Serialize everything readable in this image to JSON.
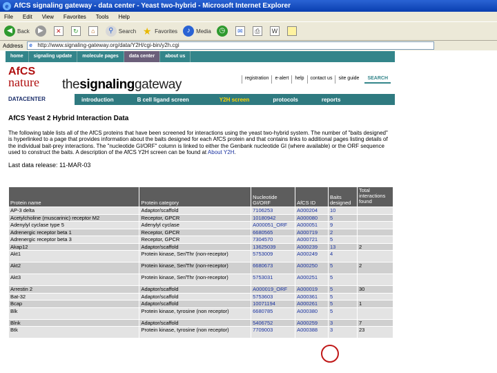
{
  "window": {
    "title": "AfCS signaling gateway - data center - Yeast two-hybrid - Microsoft Internet Explorer"
  },
  "menu": [
    "File",
    "Edit",
    "View",
    "Favorites",
    "Tools",
    "Help"
  ],
  "toolbar": {
    "back": "Back",
    "search": "Search",
    "favorites": "Favorites",
    "media": "Media"
  },
  "address": {
    "label": "Address",
    "url": "http://www.signaling-gateway.org/data/Y2H/cgi-bin/y2h.cgi"
  },
  "topnav": [
    "home",
    "signaling update",
    "molecule pages",
    "data center",
    "about us"
  ],
  "topnav_active": "data center",
  "logo": {
    "afcs_top": "AfCS",
    "afcs_bottom": "nature",
    "site_prefix": "the",
    "site_bold": "signaling",
    "site_suffix": "gateway"
  },
  "utilnav": [
    "registration",
    "e-alert",
    "help",
    "contact us",
    "site guide"
  ],
  "search_label": "SEARCH",
  "datacenter_label": "DATACENTER",
  "secnav": [
    "introduction",
    "B cell ligand screen",
    "Y2H screen",
    "protocols",
    "reports"
  ],
  "secnav_active": "Y2H screen",
  "heading": "AfCS Yeast 2 Hybrid Interaction Data",
  "intro": "The following table lists all of the AfCS proteins that have been screened for interactions using the yeast two-hybrid system. The number of \"baits designed\" is hyperlinked to a page that provides information about the baits designed for each AfCS protein and that contains links to additional pages listing details of the individual bait-prey interactions. The \"nucleotide GI/ORF\" column is linked to either the Genbank nucleotide GI (where available) or the ORF sequence used to construct the baits. A description of the AfCS Y2H screen can be found at",
  "intro_link": "About Y2H",
  "release": "Last data release: 11-MAR-03",
  "table": {
    "headers": [
      "Protein name",
      "Protein category",
      "Nucleotide GI/ORF",
      "AfCS ID",
      "Baits designed",
      "Total interactions found"
    ],
    "rows": [
      [
        "AP-3 delta",
        "Adaptor/scaffold",
        "7106253",
        "A000204",
        "10",
        ""
      ],
      [
        "Acetylcholine (muscarinic) receptor M2",
        "Receptor, GPCR",
        "10180942",
        "A000080",
        "5",
        ""
      ],
      [
        "Adenylyl cyclase type 5",
        "Adenylyl cyclase",
        "A000051_ORF",
        "A000051",
        "9",
        ""
      ],
      [
        "Adrenergic receptor beta 1",
        "Receptor, GPCR",
        "6680565",
        "A000719",
        "2",
        ""
      ],
      [
        "Adrenergic receptor beta 3",
        "Receptor, GPCR",
        "7304570",
        "A000721",
        "5",
        ""
      ],
      [
        "Akap12",
        "Adaptor/scaffold",
        "13625039",
        "A000239",
        "13",
        "2"
      ],
      [
        "Akt1",
        "Protein kinase, Ser/Thr (non-receptor)",
        "5753009",
        "A000249",
        "4",
        ""
      ],
      [
        "Akt2",
        "Protein kinase, Ser/Thr (non-receptor)",
        "6680673",
        "A000250",
        "5",
        "2"
      ],
      [
        "Akt3",
        "Protein kinase, Ser/Thr (non-receptor)",
        "5753031",
        "A000251",
        "5",
        ""
      ],
      [
        "Arrestin 2",
        "Adaptor/scaffold",
        "A000019_ORF",
        "A000019",
        "5",
        "30"
      ],
      [
        "Bat-32",
        "Adaptor/scaffold",
        "5753603",
        "A000361",
        "5",
        ""
      ],
      [
        "Bcap",
        "Adaptor/scaffold",
        "10071194",
        "A000261",
        "5",
        "1"
      ],
      [
        "Blk",
        "Protein kinase, tyrosine (non receptor)",
        "6680785",
        "A000380",
        "5",
        ""
      ],
      [
        "Blnk",
        "Adaptor/scaffold",
        "5406752",
        "A000259",
        "3",
        "7"
      ],
      [
        "Btk",
        "Protein kinase, tyrosine (non receptor)",
        "7709003",
        "A000388",
        "3",
        "23"
      ]
    ]
  }
}
